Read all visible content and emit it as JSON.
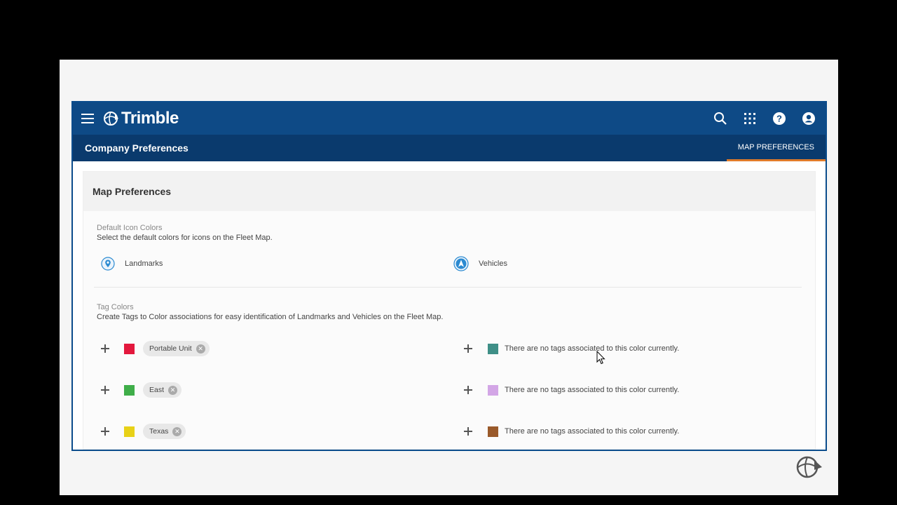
{
  "app": {
    "brand": "Trimble",
    "icons": [
      "menu-icon",
      "search-icon",
      "apps-grid-icon",
      "help-icon",
      "account-icon"
    ]
  },
  "subheader": {
    "title": "Company Preferences",
    "tab": "MAP PREFERENCES"
  },
  "card": {
    "title": "Map Preferences"
  },
  "default_icons": {
    "title": "Default Icon Colors",
    "description": "Select the default colors for icons on the Fleet Map.",
    "landmarks_label": "Landmarks",
    "vehicles_label": "Vehicles"
  },
  "tag_colors": {
    "title": "Tag Colors",
    "description": "Create Tags to Color associations for easy identification of Landmarks and Vehicles on the Fleet Map.",
    "left": [
      {
        "color": "#e3183d",
        "tag": "Portable Unit"
      },
      {
        "color": "#3fae49",
        "tag": "East"
      },
      {
        "color": "#e8d117",
        "tag": "Texas"
      }
    ],
    "right": [
      {
        "color": "#3f8f87",
        "message": "There are no tags associated to this color currently."
      },
      {
        "color": "#d3a6e6",
        "message": "There are no tags associated to this color currently."
      },
      {
        "color": "#9a5a2a",
        "message": "There are no tags associated to this color currently."
      }
    ]
  },
  "colors": {
    "topbar": "#0e4a86",
    "subbar": "#0a3a6d",
    "tab_underline": "#e07b2a"
  }
}
